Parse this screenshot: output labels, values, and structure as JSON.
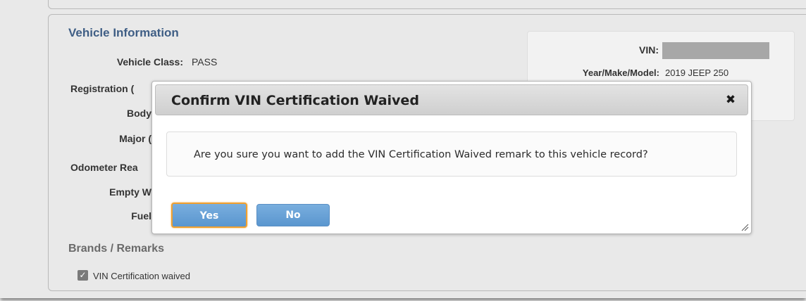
{
  "vehicle_info": {
    "title": "Vehicle Information",
    "fields": [
      {
        "label": "Vehicle Class:",
        "value": "PASS"
      },
      {
        "label": "Registration (",
        "value": ""
      },
      {
        "label": "Body",
        "value": ""
      },
      {
        "label": "Major (",
        "value": ""
      },
      {
        "label": "Odometer Rea",
        "value": ""
      },
      {
        "label": "Empty W",
        "value": ""
      },
      {
        "label": "Fuel",
        "value": ""
      }
    ]
  },
  "vin_panel": {
    "vin_label": "VIN:",
    "ymm_label": "Year/Make/Model:",
    "ymm_value": "2019 JEEP 250"
  },
  "brands": {
    "title": "Brands / Remarks",
    "items": [
      {
        "label": "VIN Certification waived",
        "checked": true
      }
    ]
  },
  "modal": {
    "title": "Confirm VIN Certification Waived",
    "message": "Are you sure you want to add the VIN Certification Waived remark to this vehicle record?",
    "yes_label": "Yes",
    "no_label": "No",
    "close_glyph": "✖"
  },
  "colors": {
    "section_title": "#3f5e85",
    "button": "#5a96cf",
    "focus_ring": "#f0a030"
  }
}
